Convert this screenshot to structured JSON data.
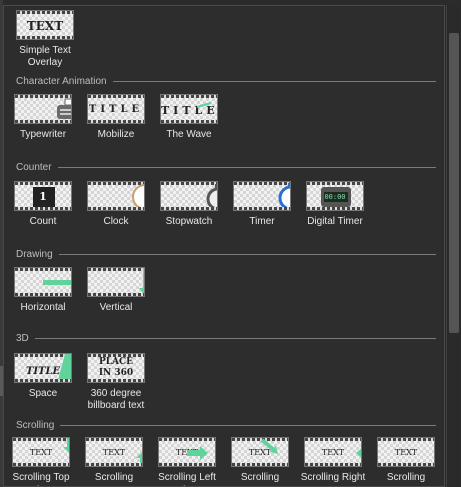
{
  "top": {
    "items": [
      {
        "label": "Simple Text Overlay",
        "thumb_text": "TEXT"
      }
    ]
  },
  "categories": [
    {
      "title": "Character Animation",
      "items": [
        {
          "label": "Typewriter",
          "icon": "typewriter-icon"
        },
        {
          "label": "Mobilize",
          "thumb_text": "TITLE"
        },
        {
          "label": "The Wave",
          "thumb_text": "TITLE"
        }
      ]
    },
    {
      "title": "Counter",
      "items": [
        {
          "label": "Count",
          "thumb_text": "1"
        },
        {
          "label": "Clock",
          "icon": "clock-icon"
        },
        {
          "label": "Stopwatch",
          "icon": "stopwatch-icon"
        },
        {
          "label": "Timer",
          "icon": "timer-icon"
        },
        {
          "label": "Digital Timer",
          "thumb_text": "00:00"
        }
      ]
    },
    {
      "title": "Drawing",
      "items": [
        {
          "label": "Horizontal",
          "icon": "horizontal-arrow-icon"
        },
        {
          "label": "Vertical",
          "icon": "vertical-arrow-icon"
        }
      ]
    },
    {
      "title": "3D",
      "items": [
        {
          "label": "Space",
          "thumb_text": "TITLE"
        },
        {
          "label": "360 degree billboard text",
          "thumb_text": "PLACE IN 360"
        }
      ]
    },
    {
      "title": "Scrolling",
      "items": [
        {
          "label": "Scrolling Top to",
          "thumb_text": "TEXT"
        },
        {
          "label": "Scrolling",
          "thumb_text": "TEXT"
        },
        {
          "label": "Scrolling Left to",
          "thumb_text": "TEXT"
        },
        {
          "label": "Scrolling",
          "thumb_text": "TEXT"
        },
        {
          "label": "Scrolling Right",
          "thumb_text": "TEXT"
        },
        {
          "label": "Scrolling",
          "thumb_text": "TEXT"
        }
      ]
    }
  ],
  "colors": {
    "accent": "#5fd39a",
    "panel": "#2d2d2d",
    "divider": "#7a7a7a"
  }
}
